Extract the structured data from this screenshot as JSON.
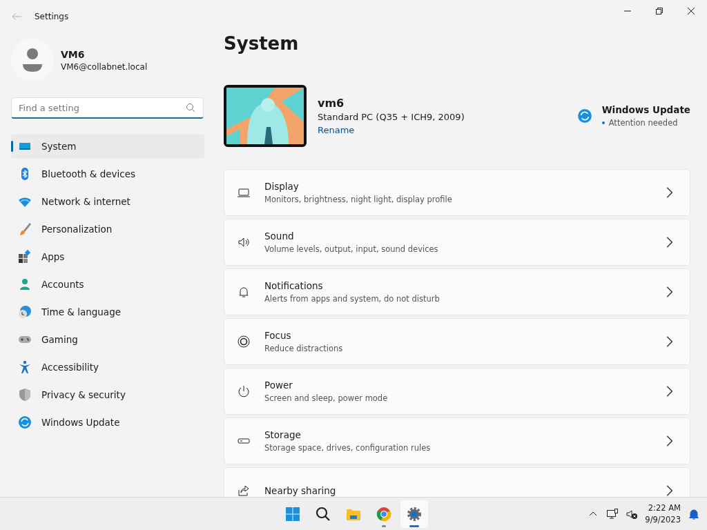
{
  "window": {
    "title": "Settings"
  },
  "profile": {
    "name": "VM6",
    "email": "VM6@collabnet.local"
  },
  "search": {
    "placeholder": "Find a setting"
  },
  "sidebar": {
    "items": [
      {
        "label": "System",
        "selected": true
      },
      {
        "label": "Bluetooth & devices",
        "selected": false
      },
      {
        "label": "Network & internet",
        "selected": false
      },
      {
        "label": "Personalization",
        "selected": false
      },
      {
        "label": "Apps",
        "selected": false
      },
      {
        "label": "Accounts",
        "selected": false
      },
      {
        "label": "Time & language",
        "selected": false
      },
      {
        "label": "Gaming",
        "selected": false
      },
      {
        "label": "Accessibility",
        "selected": false
      },
      {
        "label": "Privacy & security",
        "selected": false
      },
      {
        "label": "Windows Update",
        "selected": false
      }
    ]
  },
  "page": {
    "title": "System",
    "device": {
      "name": "vm6",
      "model": "Standard PC (Q35 + ICH9, 2009)",
      "rename": "Rename"
    },
    "update": {
      "title": "Windows Update",
      "status": "Attention needed"
    },
    "cards": [
      {
        "title": "Display",
        "subtitle": "Monitors, brightness, night light, display profile"
      },
      {
        "title": "Sound",
        "subtitle": "Volume levels, output, input, sound devices"
      },
      {
        "title": "Notifications",
        "subtitle": "Alerts from apps and system, do not disturb"
      },
      {
        "title": "Focus",
        "subtitle": "Reduce distractions"
      },
      {
        "title": "Power",
        "subtitle": "Screen and sleep, power mode"
      },
      {
        "title": "Storage",
        "subtitle": "Storage space, drives, configuration rules"
      },
      {
        "title": "Nearby sharing"
      }
    ]
  },
  "taskbar": {
    "apps": [
      {
        "running": false,
        "selected": false
      },
      {
        "running": false,
        "selected": false
      },
      {
        "running": false,
        "selected": false
      },
      {
        "running": true,
        "selected": false
      },
      {
        "running": true,
        "selected": true
      }
    ],
    "time": "2:22 AM",
    "date": "9/9/2023"
  }
}
